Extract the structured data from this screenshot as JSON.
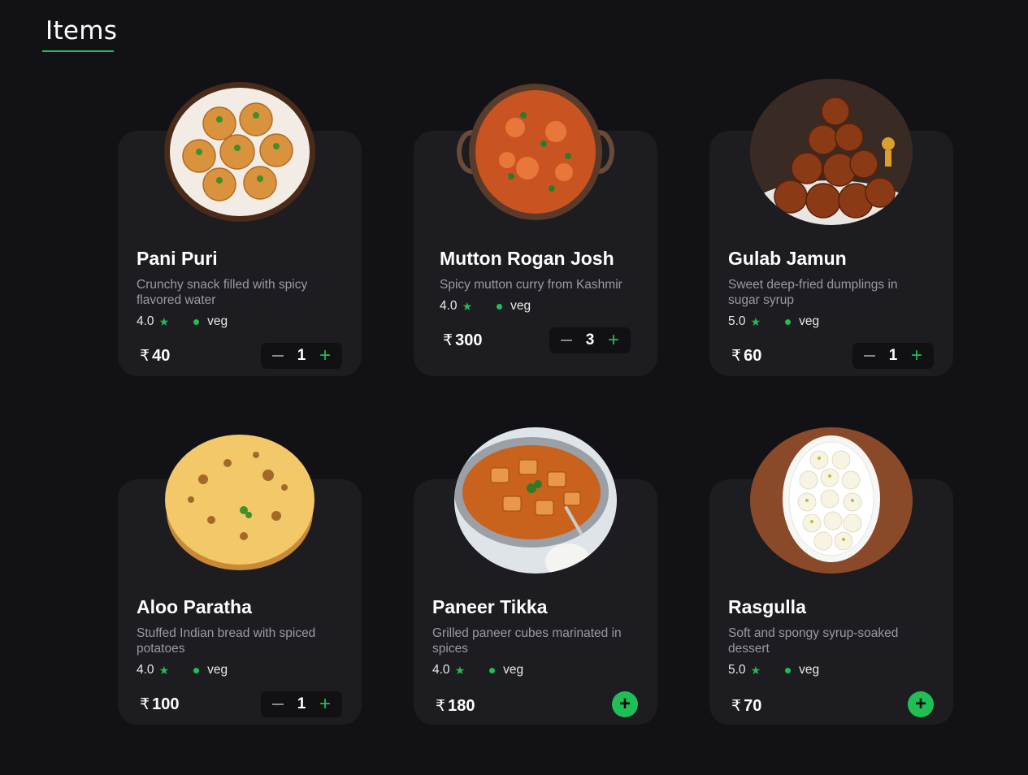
{
  "page": {
    "title": "Items"
  },
  "colors": {
    "accent": "#1fbf56",
    "background": "#121216",
    "card": "#1c1c21"
  },
  "items": [
    {
      "name": "Pani Puri",
      "description": "Crunchy snack filled with spicy flavored water",
      "rating": "4.0",
      "type": "veg",
      "currency": "₹",
      "price": "40",
      "quantity": "1",
      "in_cart": true
    },
    {
      "name": "Mutton Rogan Josh",
      "description": "Spicy mutton curry from Kashmir",
      "rating": "4.0",
      "type": "veg",
      "currency": "₹",
      "price": "300",
      "quantity": "3",
      "in_cart": true
    },
    {
      "name": "Gulab Jamun",
      "description": "Sweet deep-fried dumplings in sugar syrup",
      "rating": "5.0",
      "type": "veg",
      "currency": "₹",
      "price": "60",
      "quantity": "1",
      "in_cart": true
    },
    {
      "name": "Aloo Paratha",
      "description": "Stuffed Indian bread with spiced potatoes",
      "rating": "4.0",
      "type": "veg",
      "currency": "₹",
      "price": "100",
      "quantity": "1",
      "in_cart": true
    },
    {
      "name": "Paneer Tikka",
      "description": "Grilled paneer cubes marinated in spices",
      "rating": "4.0",
      "type": "veg",
      "currency": "₹",
      "price": "180",
      "quantity": "0",
      "in_cart": false
    },
    {
      "name": "Rasgulla",
      "description": "Soft and spongy syrup-soaked dessert",
      "rating": "5.0",
      "type": "veg",
      "currency": "₹",
      "price": "70",
      "quantity": "0",
      "in_cart": false
    }
  ],
  "icons": {
    "rating": "star-icon",
    "veg": "veg-dot-icon",
    "decrement": "minus-icon",
    "increment": "plus-icon",
    "add": "add-icon"
  }
}
